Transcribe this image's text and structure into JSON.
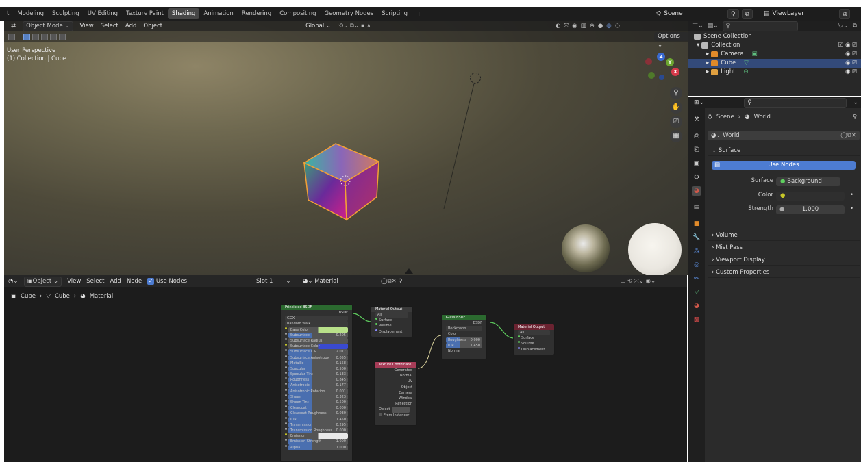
{
  "workspace_tabs": [
    "t",
    "Modeling",
    "Sculpting",
    "UV Editing",
    "Texture Paint",
    "Shading",
    "Animation",
    "Rendering",
    "Compositing",
    "Geometry Nodes",
    "Scripting"
  ],
  "active_tab_index": 5,
  "add_tab_glyph": "+",
  "scene_label": "Scene",
  "viewlayer_label": "ViewLayer",
  "viewport": {
    "mode": "Object Mode",
    "menus": [
      "View",
      "Select",
      "Add",
      "Object"
    ],
    "transform": "Global",
    "info_line1": "User Perspective",
    "info_line2": "(1) Collection | Cube",
    "options_label": "Options"
  },
  "gizmo": {
    "z": "Z",
    "y": "Y",
    "x": "X"
  },
  "node_editor": {
    "type_label": "Object",
    "menus": [
      "View",
      "Select",
      "Add",
      "Node"
    ],
    "use_nodes_label": "Use Nodes",
    "slot_label": "Slot 1",
    "material_label": "Material",
    "breadcrumb": [
      "Cube",
      "Cube",
      "Material"
    ],
    "bsdf_title": "Principled BSDF",
    "bsdf_out": "BSDF",
    "bsdf_rows": [
      {
        "l": "GGX",
        "v": ""
      },
      {
        "l": "Random Walk",
        "v": ""
      },
      {
        "l": "Base Color",
        "v": ""
      },
      {
        "l": "Subsurface",
        "v": "0.205"
      },
      {
        "l": "Subsurface Radius",
        "v": ""
      },
      {
        "l": "Subsurface Color",
        "v": ""
      },
      {
        "l": "Subsurface IOR",
        "v": "2.077"
      },
      {
        "l": "Subsurface Anisotropy",
        "v": "0.055"
      },
      {
        "l": "Metallic",
        "v": "0.158"
      },
      {
        "l": "Specular",
        "v": "0.500"
      },
      {
        "l": "Specular Tint",
        "v": "0.133"
      },
      {
        "l": "Roughness",
        "v": "0.845"
      },
      {
        "l": "Anisotropic",
        "v": "0.177"
      },
      {
        "l": "Anisotropic Rotation",
        "v": "0.001"
      },
      {
        "l": "Sheen",
        "v": "0.323"
      },
      {
        "l": "Sheen Tint",
        "v": "0.500"
      },
      {
        "l": "Clearcoat",
        "v": "0.000"
      },
      {
        "l": "Clearcoat Roughness",
        "v": "0.030"
      },
      {
        "l": "IOR",
        "v": "7.450"
      },
      {
        "l": "Transmission",
        "v": "0.295"
      },
      {
        "l": "Transmission Roughness",
        "v": "0.000"
      },
      {
        "l": "Emission",
        "v": ""
      },
      {
        "l": "Emission Strength",
        "v": "1.000"
      },
      {
        "l": "Alpha",
        "v": "1.000"
      }
    ],
    "matout1_title": "Material Output",
    "matout1_rows": [
      "All",
      "Surface",
      "Volume",
      "Displacement"
    ],
    "texcoord_title": "Texture Coordinate",
    "texcoord_rows": [
      "Generated",
      "Normal",
      "UV",
      "Object",
      "Camera",
      "Window",
      "Reflection"
    ],
    "texcoord_object": "Object",
    "texcoord_instancer": "From Instancer",
    "glass_title": "Glass BSDF",
    "glass_out": "BSDF",
    "glass_rows": [
      {
        "l": "Beckmann",
        "v": ""
      },
      {
        "l": "Color",
        "v": ""
      },
      {
        "l": "Roughness",
        "v": "0.000"
      },
      {
        "l": "IOR",
        "v": "1.450"
      },
      {
        "l": "Normal",
        "v": ""
      }
    ],
    "matout2_title": "Material Output",
    "matout2_rows": [
      "All",
      "Surface",
      "Volume",
      "Displacement"
    ]
  },
  "outliner": {
    "root": "Scene Collection",
    "items": [
      {
        "name": "Collection",
        "sel": false
      },
      {
        "name": "Camera",
        "sel": false
      },
      {
        "name": "Cube",
        "sel": true
      },
      {
        "name": "Light",
        "sel": false
      }
    ]
  },
  "properties": {
    "breadcrumb_scene": "Scene",
    "breadcrumb_world": "World",
    "world_field": "World",
    "surface_section": "Surface",
    "use_nodes_btn": "Use Nodes",
    "surface_label": "Surface",
    "surface_value": "Background",
    "color_label": "Color",
    "strength_label": "Strength",
    "strength_value": "1.000",
    "sections": [
      "Volume",
      "Mist Pass",
      "Viewport Display",
      "Custom Properties"
    ]
  },
  "colors": {
    "accent": "#4d7cd1",
    "selected_row": "#334a7a",
    "node_green": "#2b6a2f",
    "node_pink": "#a63c57"
  }
}
